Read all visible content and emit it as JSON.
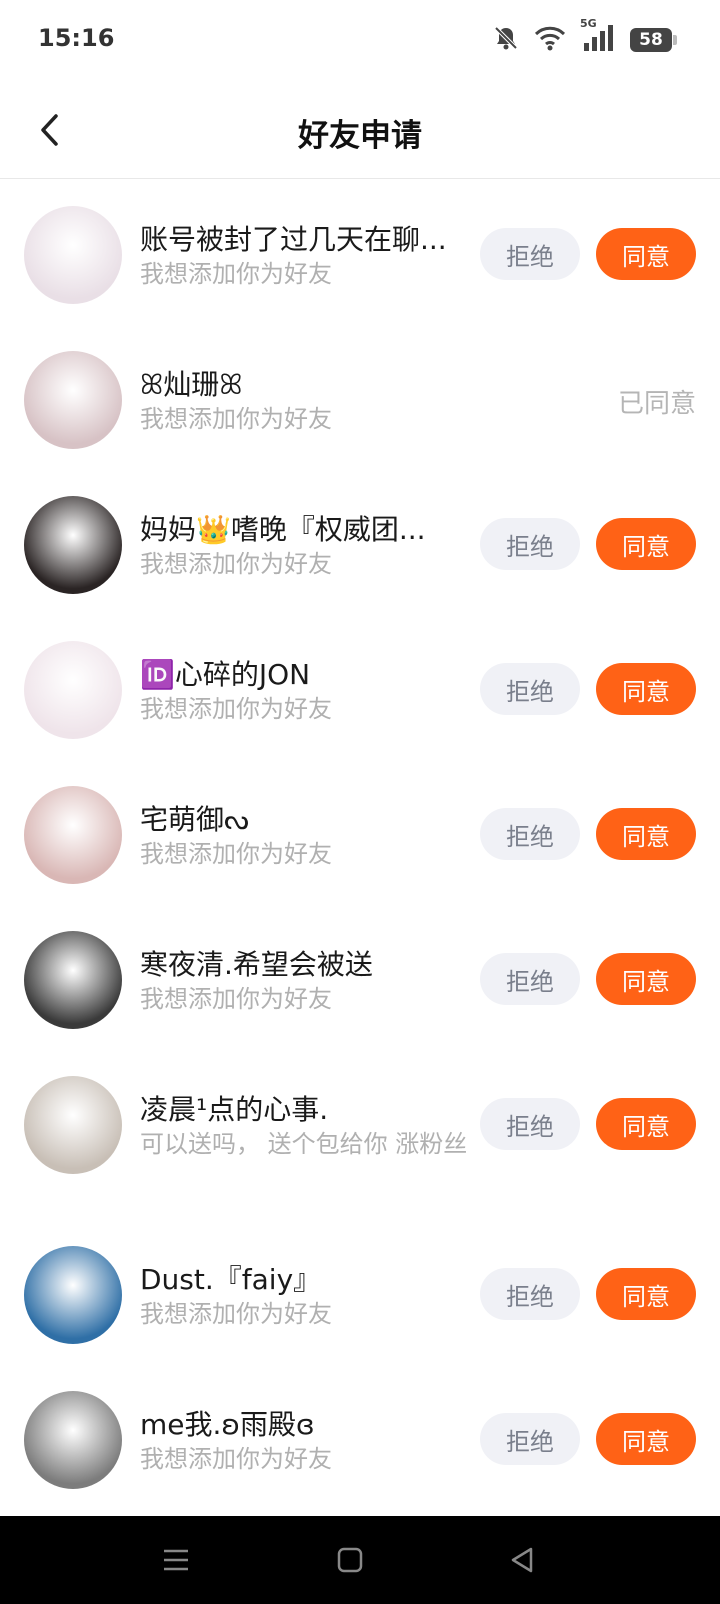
{
  "status_bar": {
    "time": "15:16",
    "network": "5G",
    "battery": "58"
  },
  "header": {
    "title": "好友申请"
  },
  "buttons": {
    "reject": "拒绝",
    "accept": "同意"
  },
  "requests": [
    {
      "name": "账号被封了过几天在聊...",
      "message": "我想添加你为好友",
      "status": "pending",
      "avatar_color": "#e9dfe6"
    },
    {
      "name": "ꕤ灿珊ꕤ",
      "message": "我想添加你为好友",
      "status": "accepted",
      "accepted_label": "已同意",
      "avatar_color": "#d7c2c5"
    },
    {
      "name": "妈妈👑嗜晚『权威团...",
      "message": "我想添加你为好友",
      "status": "pending",
      "avatar_color": "#2a2424"
    },
    {
      "name": "🆔心碎的JON",
      "message": "我想添加你为好友",
      "status": "pending",
      "avatar_color": "#efe4ea"
    },
    {
      "name": "宅萌御ᔓ",
      "message": "我想添加你为好友",
      "status": "pending",
      "avatar_color": "#d9b7b5"
    },
    {
      "name": "寒夜清.希望会被送",
      "message": "我想添加你为好友",
      "status": "pending",
      "avatar_color": "#3a3a3a"
    },
    {
      "name": "凌晨¹点的心事.",
      "message": "可以送吗， 送个包给你 涨粉丝",
      "status": "pending",
      "avatar_color": "#c8bfb6"
    },
    {
      "name": "Dust.『faiy』",
      "message": "我想添加你为好友",
      "status": "pending",
      "avatar_color": "#2f6fa6"
    },
    {
      "name": "me我.ʚ雨殿ɞ",
      "message": "我想添加你为好友",
      "status": "pending",
      "avatar_color": "#7c7c7c"
    }
  ],
  "colors": {
    "accent": "#ff6216",
    "reject_bg": "#f0f1f6",
    "subtext": "#b0b0b0"
  }
}
